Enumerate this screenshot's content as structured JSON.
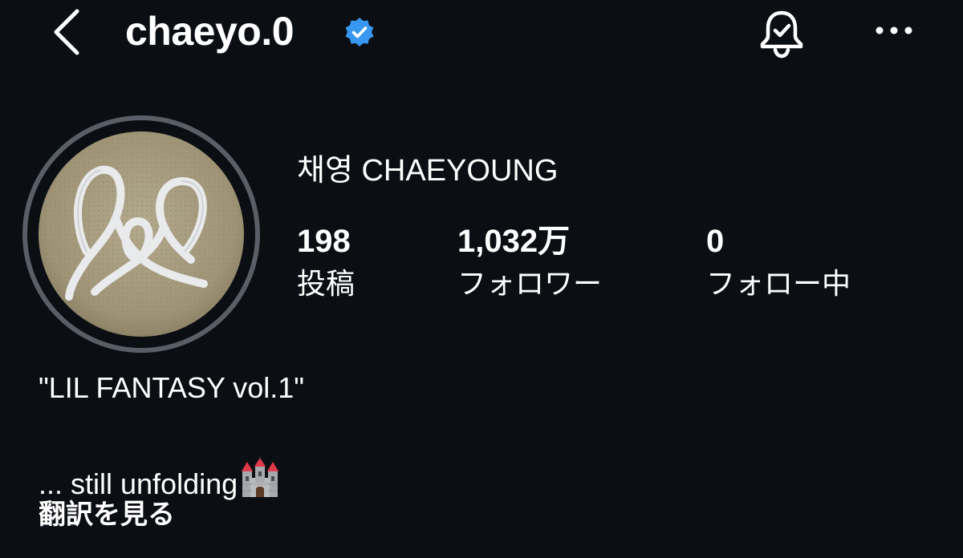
{
  "header": {
    "username": "chaeyo.0",
    "verified": true,
    "icons": [
      "back-chevron-icon",
      "verified-badge-icon",
      "notification-bell-icon",
      "more-options-icon"
    ]
  },
  "profile": {
    "display_name": "채영 CHAEYOUNG",
    "stats": [
      {
        "value": "198",
        "label": "投稿"
      },
      {
        "value": "1,032万",
        "label": "フォロワー"
      },
      {
        "value": "0",
        "label": "フォロー中"
      }
    ],
    "bio_line1": "\"LIL FANTASY vol.1\"",
    "bio_line2": "... still unfolding",
    "bio_emoji": "castle-emoji",
    "translate_label": "翻訳を見る"
  },
  "colors": {
    "background": "#0b0e13",
    "text": "#ffffff",
    "verified_blue": "#3897f0",
    "avatar_ring": "#5a5e66"
  }
}
